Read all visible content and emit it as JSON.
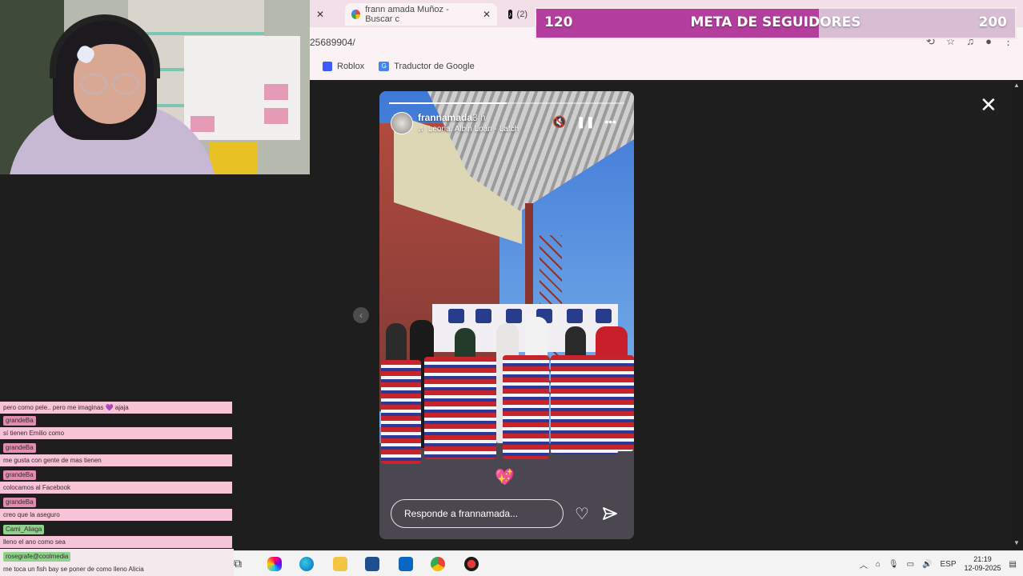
{
  "browser": {
    "tabs": [
      {
        "label": "",
        "close": "✕"
      },
      {
        "label": "frann amada Muñoz - Buscar c",
        "close": "✕"
      },
      {
        "label": "(2)",
        "close": ""
      }
    ],
    "url": "25689904/",
    "bookmarks": [
      {
        "label": "Roblox"
      },
      {
        "label": "Traductor de Google"
      }
    ]
  },
  "goal": {
    "start": "120",
    "title": "META DE SEGUIDORES",
    "end": "200",
    "progress_fraction": 0.59,
    "fill_color": "#b43e9d"
  },
  "story": {
    "username": "frannamada",
    "time": "3 h",
    "music": "♬ Leona, Albin Loán · Latch",
    "reply_placeholder": "Responde a frannamada...",
    "progress_fraction": 0.5,
    "icons": [
      "mute-icon",
      "pause-icon",
      "more-icon",
      "heart-icon",
      "send-icon",
      "close-icon"
    ]
  },
  "chat": {
    "lines": [
      {
        "user": "",
        "text": "pero como pele.. pero me imaginas 💜 ajaja"
      },
      {
        "user": "grandeBa",
        "text": "sí tienen Emilio como"
      },
      {
        "user": "grandeBa",
        "text": "me gusta con gente de mas tienen"
      },
      {
        "user": "grandeBa",
        "text": "colocamos al Facebook"
      },
      {
        "user": "grandeBa",
        "text": "creo que la aseguro"
      },
      {
        "user": "Cami_Aliaga",
        "text": "lleno el ano como sea"
      }
    ],
    "bottom_user": "rosegrafe@coolmedia",
    "bottom_text": "me toca un fish bay se poner de como lleno Alicia"
  },
  "taskbar": {
    "lang": "ESP",
    "time": "21:19",
    "date": "12-09-2025"
  }
}
